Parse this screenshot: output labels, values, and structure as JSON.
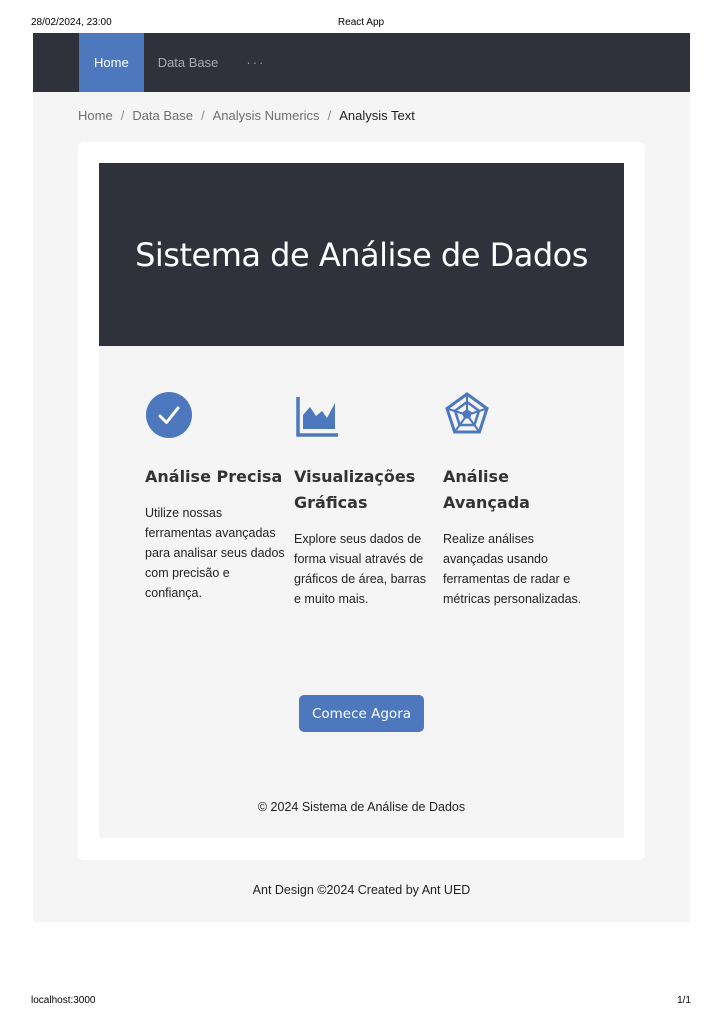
{
  "print": {
    "datetime": "28/02/2024, 23:00",
    "doc_title": "React App",
    "url": "localhost:3000",
    "page_count": "1/1"
  },
  "nav": {
    "items": [
      {
        "label": "Home",
        "active": true
      },
      {
        "label": "Data Base",
        "active": false
      },
      {
        "label": "···",
        "active": false
      }
    ]
  },
  "breadcrumb": {
    "items": [
      "Home",
      "Data Base",
      "Analysis Numerics",
      "Analysis Text"
    ],
    "separator": "/"
  },
  "hero": {
    "title": "Sistema de Análise de Dados"
  },
  "features": [
    {
      "icon": "check-circle-icon",
      "title": "Análise Precisa",
      "text": "Utilize nossas ferramentas avançadas para analisar seus dados com precisão e confiança."
    },
    {
      "icon": "area-chart-icon",
      "title": "Visualizações Gráficas",
      "text": "Explore seus dados de forma visual através de gráficos de área, barras e muito mais."
    },
    {
      "icon": "radar-chart-icon",
      "title": "Análise Avançada",
      "text": "Realize análises avançadas usando ferramentas de radar e métricas personalizadas."
    }
  ],
  "cta": {
    "label": "Comece Agora"
  },
  "inner_footer": "© 2024 Sistema de Análise de Dados",
  "app_footer": "Ant Design ©2024 Created by Ant UED",
  "colors": {
    "nav_bg": "#2f323b",
    "accent": "#4d78bd",
    "page_bg": "#f5f5f5"
  }
}
